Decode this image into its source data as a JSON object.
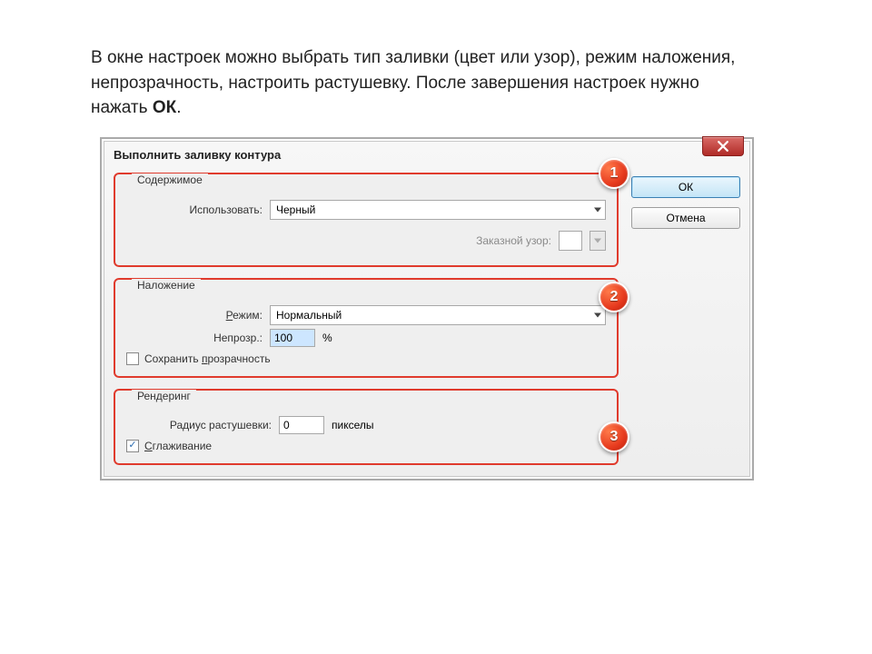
{
  "intro": {
    "text_before_bold": "В окне настроек можно выбрать тип заливки (цвет или узор), режим наложения, непрозрачность, настроить растушевку. После завершения настроек нужно нажать ",
    "bold": "ОК",
    "text_after_bold": "."
  },
  "dialog": {
    "title": "Выполнить заливку контура",
    "ok_label": "ОК",
    "cancel_label": "Отмена"
  },
  "group1": {
    "legend": "Содержимое",
    "use_label": "Использовать:",
    "use_value": "Черный",
    "pattern_label": "Заказной узор:"
  },
  "group2": {
    "legend": "Наложение",
    "mode_label": "Режим:",
    "mode_value": "Нормальный",
    "opacity_label": "Непрозр.:",
    "opacity_value": "100",
    "opacity_suffix": "%",
    "preserve_prefix": "Сохранить ",
    "preserve_letter": "п",
    "preserve_rest": "розрачность"
  },
  "group3": {
    "legend": "Рендеринг",
    "radius_label": "Радиус растушевки:",
    "radius_value": "0",
    "radius_suffix": "пикселы",
    "aa_letter": "С",
    "aa_rest": "глаживание"
  },
  "callouts": {
    "one": "1",
    "two": "2",
    "three": "3"
  }
}
